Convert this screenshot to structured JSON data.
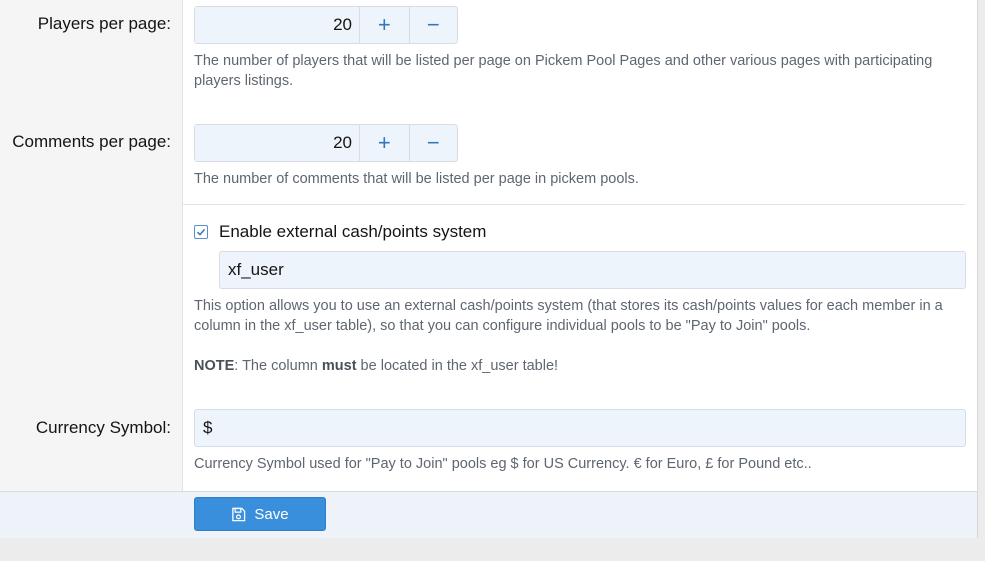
{
  "players_per_page": {
    "label": "Players per page:",
    "value": "20",
    "plus": "+",
    "minus": "−",
    "hint": "The number of players that will be listed per page on Pickem Pool Pages and other various pages with participating players listings."
  },
  "comments_per_page": {
    "label": "Comments per page:",
    "value": "20",
    "plus": "+",
    "minus": "−",
    "hint": "The number of comments that will be listed per page in pickem pools."
  },
  "external_cash": {
    "checkbox_label": "Enable external cash/points system",
    "checked": true,
    "column_value": "xf_user",
    "hint": "This option allows you to use an external cash/points system (that stores its cash/points values for each member in a column in the xf_user table), so that you can configure individual pools to be \"Pay to Join\" pools.",
    "note_prefix": "NOTE",
    "note_part1": ": The column ",
    "note_bold": "must",
    "note_part2": " be located in the xf_user table!"
  },
  "currency": {
    "label": "Currency Symbol:",
    "value": "$",
    "hint": "Currency Symbol used for \"Pay to Join\" pools eg $ for US Currency. € for Euro, £ for Pound etc.."
  },
  "footer": {
    "save_label": "Save",
    "save_icon": "save-icon"
  },
  "colors": {
    "accent": "#3a8fdc",
    "spin_icon": "#2f77c0"
  }
}
